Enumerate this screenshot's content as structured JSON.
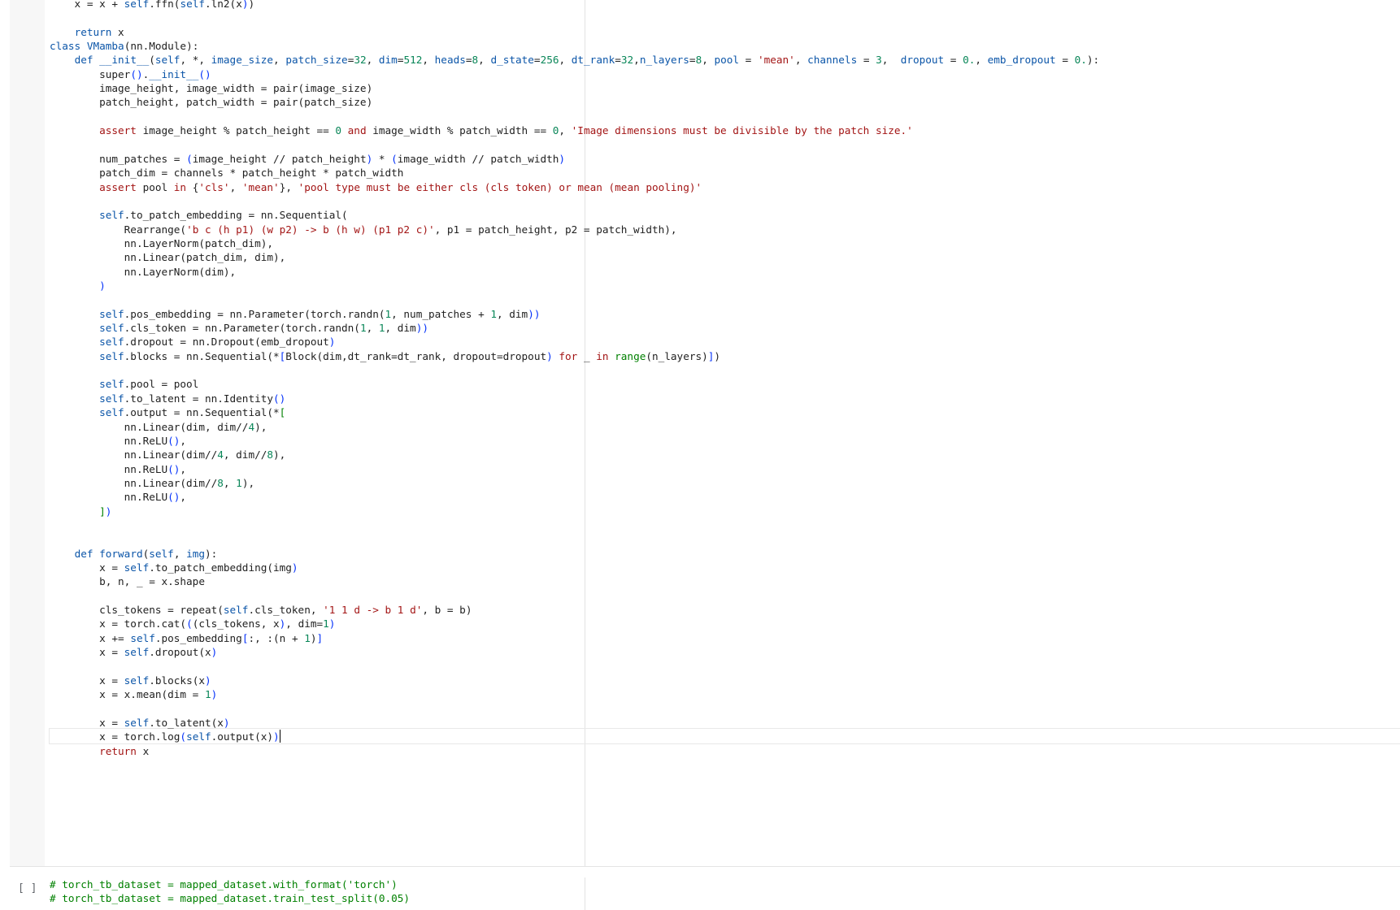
{
  "cells": [
    {
      "id": "cell-main",
      "lines": [
        [
          [
            "t",
            "    x = x + "
          ],
          [
            "k",
            "self"
          ],
          [
            "t",
            ".ffn("
          ],
          [
            "k",
            "self"
          ],
          [
            "t",
            ".ln2("
          ],
          [
            "t",
            "x"
          ],
          [
            "p",
            ")"
          ],
          [
            "t",
            ")"
          ]
        ],
        [],
        [
          [
            "t",
            "    "
          ],
          [
            "k",
            "return"
          ],
          [
            "t",
            " x"
          ]
        ],
        [
          [
            "k",
            "class"
          ],
          [
            "t",
            " "
          ],
          [
            "k",
            "VMamba"
          ],
          [
            "t",
            "(nn.Module):"
          ]
        ],
        [
          [
            "t",
            "    "
          ],
          [
            "k",
            "def"
          ],
          [
            "t",
            " "
          ],
          [
            "k",
            "__init__"
          ],
          [
            "t",
            "("
          ],
          [
            "k",
            "self"
          ],
          [
            "t",
            ", *, "
          ],
          [
            "k",
            "image_size"
          ],
          [
            "t",
            ", "
          ],
          [
            "k",
            "patch_size"
          ],
          [
            "t",
            "="
          ],
          [
            "n",
            "32"
          ],
          [
            "t",
            ", "
          ],
          [
            "k",
            "dim"
          ],
          [
            "t",
            "="
          ],
          [
            "n",
            "512"
          ],
          [
            "t",
            ", "
          ],
          [
            "k",
            "heads"
          ],
          [
            "t",
            "="
          ],
          [
            "n",
            "8"
          ],
          [
            "t",
            ", "
          ],
          [
            "k",
            "d_state"
          ],
          [
            "t",
            "="
          ],
          [
            "n",
            "256"
          ],
          [
            "t",
            ", "
          ],
          [
            "k",
            "dt_rank"
          ],
          [
            "t",
            "="
          ],
          [
            "n",
            "32"
          ],
          [
            "t",
            ","
          ],
          [
            "k",
            "n_layers"
          ],
          [
            "t",
            "="
          ],
          [
            "n",
            "8"
          ],
          [
            "t",
            ", "
          ],
          [
            "k",
            "pool"
          ],
          [
            "t",
            " = "
          ],
          [
            "s",
            "'mean'"
          ],
          [
            "t",
            ", "
          ],
          [
            "k",
            "channels"
          ],
          [
            "t",
            " = "
          ],
          [
            "n",
            "3"
          ],
          [
            "t",
            ",  "
          ],
          [
            "k",
            "dropout"
          ],
          [
            "t",
            " = "
          ],
          [
            "n",
            "0."
          ],
          [
            "t",
            ", "
          ],
          [
            "k",
            "emb_dropout"
          ],
          [
            "t",
            " = "
          ],
          [
            "n",
            "0."
          ],
          [
            "t",
            "):"
          ]
        ],
        [
          [
            "t",
            "        super"
          ],
          [
            "p",
            "()"
          ],
          [
            "t",
            "."
          ],
          [
            "k",
            "__init__"
          ],
          [
            "p",
            "()"
          ]
        ],
        [
          [
            "t",
            "        image_height, image_width = pair(image_size)"
          ]
        ],
        [
          [
            "t",
            "        patch_height, patch_width = pair(patch_size)"
          ]
        ],
        [],
        [
          [
            "t",
            "        "
          ],
          [
            "s",
            "assert"
          ],
          [
            "t",
            " image_height % patch_height == "
          ],
          [
            "n",
            "0"
          ],
          [
            "t",
            " "
          ],
          [
            "s",
            "and"
          ],
          [
            "t",
            " image_width % patch_width == "
          ],
          [
            "n",
            "0"
          ],
          [
            "t",
            ", "
          ],
          [
            "s",
            "'Image dimensions must be divisible by the patch size.'"
          ]
        ],
        [],
        [
          [
            "t",
            "        num_patches = "
          ],
          [
            "p",
            "("
          ],
          [
            "t",
            "image_height // patch_height"
          ],
          [
            "p",
            ")"
          ],
          [
            "t",
            " * "
          ],
          [
            "p",
            "("
          ],
          [
            "t",
            "image_width // patch_width"
          ],
          [
            "p",
            ")"
          ]
        ],
        [
          [
            "t",
            "        patch_dim = channels * patch_height * patch_width"
          ]
        ],
        [
          [
            "t",
            "        "
          ],
          [
            "s",
            "assert"
          ],
          [
            "t",
            " pool "
          ],
          [
            "s",
            "in"
          ],
          [
            "t",
            " {"
          ],
          [
            "s",
            "'cls'"
          ],
          [
            "t",
            ", "
          ],
          [
            "s",
            "'mean'"
          ],
          [
            "t",
            "}, "
          ],
          [
            "s",
            "'pool type must be either cls (cls token) or mean (mean pooling)'"
          ]
        ],
        [],
        [
          [
            "t",
            "        "
          ],
          [
            "k",
            "self"
          ],
          [
            "t",
            ".to_patch_embedding = nn.Sequential("
          ]
        ],
        [
          [
            "t",
            "            Rearrange("
          ],
          [
            "s",
            "'b c (h p1) (w p2) -> b (h w) (p1 p2 c)'"
          ],
          [
            "t",
            ", p1 = patch_height, p2 = patch_width),"
          ]
        ],
        [
          [
            "t",
            "            nn.LayerNorm(patch_dim),"
          ]
        ],
        [
          [
            "t",
            "            nn.Linear(patch_dim, dim),"
          ]
        ],
        [
          [
            "t",
            "            nn.LayerNorm(dim),"
          ]
        ],
        [
          [
            "t",
            "        "
          ],
          [
            "p",
            ")"
          ]
        ],
        [],
        [
          [
            "t",
            "        "
          ],
          [
            "k",
            "self"
          ],
          [
            "t",
            ".pos_embedding = nn.Parameter(torch.randn("
          ],
          [
            "n",
            "1"
          ],
          [
            "t",
            ", num_patches + "
          ],
          [
            "n",
            "1"
          ],
          [
            "t",
            ", dim"
          ],
          [
            "p",
            "))"
          ]
        ],
        [
          [
            "t",
            "        "
          ],
          [
            "k",
            "self"
          ],
          [
            "t",
            ".cls_token = nn.Parameter(torch.randn("
          ],
          [
            "n",
            "1"
          ],
          [
            "t",
            ", "
          ],
          [
            "n",
            "1"
          ],
          [
            "t",
            ", dim"
          ],
          [
            "p",
            "))"
          ]
        ],
        [
          [
            "t",
            "        "
          ],
          [
            "k",
            "self"
          ],
          [
            "t",
            ".dropout = nn.Dropout(emb_dropout"
          ],
          [
            "p",
            ")"
          ]
        ],
        [
          [
            "t",
            "        "
          ],
          [
            "k",
            "self"
          ],
          [
            "t",
            ".blocks = nn.Sequential(*"
          ],
          [
            "p",
            "["
          ],
          [
            "t",
            "Block(dim,dt_rank=dt_rank, dropout=dropout"
          ],
          [
            "p",
            ")"
          ],
          [
            "t",
            " "
          ],
          [
            "s",
            "for"
          ],
          [
            "t",
            " _ "
          ],
          [
            "s",
            "in"
          ],
          [
            "t",
            " "
          ],
          [
            "c",
            "range"
          ],
          [
            "t",
            "(n_layers)"
          ],
          [
            "p",
            "]"
          ],
          [
            "t",
            ")"
          ]
        ],
        [],
        [
          [
            "t",
            "        "
          ],
          [
            "k",
            "self"
          ],
          [
            "t",
            ".pool = pool"
          ]
        ],
        [
          [
            "t",
            "        "
          ],
          [
            "k",
            "self"
          ],
          [
            "t",
            ".to_latent = nn.Identity"
          ],
          [
            "p",
            "()"
          ]
        ],
        [
          [
            "t",
            "        "
          ],
          [
            "k",
            "self"
          ],
          [
            "t",
            ".output = nn.Sequential(*"
          ],
          [
            "c",
            "["
          ]
        ],
        [
          [
            "t",
            "            nn.Linear(dim, dim//"
          ],
          [
            "n",
            "4"
          ],
          [
            "t",
            "),"
          ]
        ],
        [
          [
            "t",
            "            nn.ReLU"
          ],
          [
            "p",
            "()"
          ],
          [
            "t",
            ","
          ]
        ],
        [
          [
            "t",
            "            nn.Linear(dim//"
          ],
          [
            "n",
            "4"
          ],
          [
            "t",
            ", dim//"
          ],
          [
            "n",
            "8"
          ],
          [
            "t",
            "),"
          ]
        ],
        [
          [
            "t",
            "            nn.ReLU"
          ],
          [
            "p",
            "()"
          ],
          [
            "t",
            ","
          ]
        ],
        [
          [
            "t",
            "            nn.Linear(dim//"
          ],
          [
            "n",
            "8"
          ],
          [
            "t",
            ", "
          ],
          [
            "n",
            "1"
          ],
          [
            "t",
            "),"
          ]
        ],
        [
          [
            "t",
            "            nn.ReLU"
          ],
          [
            "p",
            "()"
          ],
          [
            "t",
            ","
          ]
        ],
        [
          [
            "t",
            "        "
          ],
          [
            "c",
            "]"
          ],
          [
            "p",
            ")"
          ]
        ],
        [],
        [],
        [
          [
            "t",
            "    "
          ],
          [
            "k",
            "def"
          ],
          [
            "t",
            " "
          ],
          [
            "k",
            "forward"
          ],
          [
            "t",
            "("
          ],
          [
            "k",
            "self"
          ],
          [
            "t",
            ", "
          ],
          [
            "k",
            "img"
          ],
          [
            "t",
            "):"
          ]
        ],
        [
          [
            "t",
            "        x = "
          ],
          [
            "k",
            "self"
          ],
          [
            "t",
            ".to_patch_embedding(img"
          ],
          [
            "p",
            ")"
          ]
        ],
        [
          [
            "t",
            "        b, n, _ = x.shape"
          ]
        ],
        [],
        [
          [
            "t",
            "        cls_tokens = repeat("
          ],
          [
            "k",
            "self"
          ],
          [
            "t",
            ".cls_token, "
          ],
          [
            "s",
            "'1 1 d -> b 1 d'"
          ],
          [
            "t",
            ", b = b)"
          ]
        ],
        [
          [
            "t",
            "        x = torch.cat("
          ],
          [
            "p",
            "("
          ],
          [
            "t",
            "(cls_tokens, x"
          ],
          [
            "p",
            ")"
          ],
          [
            "t",
            ", dim="
          ],
          [
            "n",
            "1"
          ],
          [
            "p",
            ")"
          ]
        ],
        [
          [
            "t",
            "        x += "
          ],
          [
            "k",
            "self"
          ],
          [
            "t",
            ".pos_embedding"
          ],
          [
            "p",
            "["
          ],
          [
            "t",
            ":, :(n + "
          ],
          [
            "n",
            "1"
          ],
          [
            "t",
            ")"
          ],
          [
            "p",
            "]"
          ]
        ],
        [
          [
            "t",
            "        x = "
          ],
          [
            "k",
            "self"
          ],
          [
            "t",
            ".dropout(x"
          ],
          [
            "p",
            ")"
          ]
        ],
        [],
        [
          [
            "t",
            "        x = "
          ],
          [
            "k",
            "self"
          ],
          [
            "t",
            ".blocks(x"
          ],
          [
            "p",
            ")"
          ]
        ],
        [
          [
            "t",
            "        x = x.mean(dim = "
          ],
          [
            "n",
            "1"
          ],
          [
            "p",
            ")"
          ]
        ],
        [],
        [
          [
            "t",
            "        x = "
          ],
          [
            "k",
            "self"
          ],
          [
            "t",
            ".to_latent(x"
          ],
          [
            "p",
            ")"
          ]
        ],
        [
          [
            "t",
            "        x = torch.log"
          ],
          [
            "p",
            "("
          ],
          [
            "k",
            "self"
          ],
          [
            "t",
            ".output(x)"
          ],
          [
            "p",
            ")"
          ]
        ],
        [
          [
            "t",
            "        "
          ],
          [
            "s",
            "return"
          ],
          [
            "t",
            " x"
          ]
        ]
      ]
    },
    {
      "id": "cell-next",
      "run_indicator": "[ ]",
      "lines": [
        [
          [
            "c",
            "# torch_tb_dataset = mapped_dataset.with_format('torch')"
          ]
        ],
        [
          [
            "c",
            "# torch_tb_dataset = mapped_dataset.train_test_split(0.05)"
          ]
        ]
      ]
    }
  ],
  "theme": {
    "keyword": "#0b55a8",
    "string": "#a31515",
    "number": "#098658",
    "bracket": "#0431fa",
    "comment": "#008000",
    "text": "#212121"
  }
}
